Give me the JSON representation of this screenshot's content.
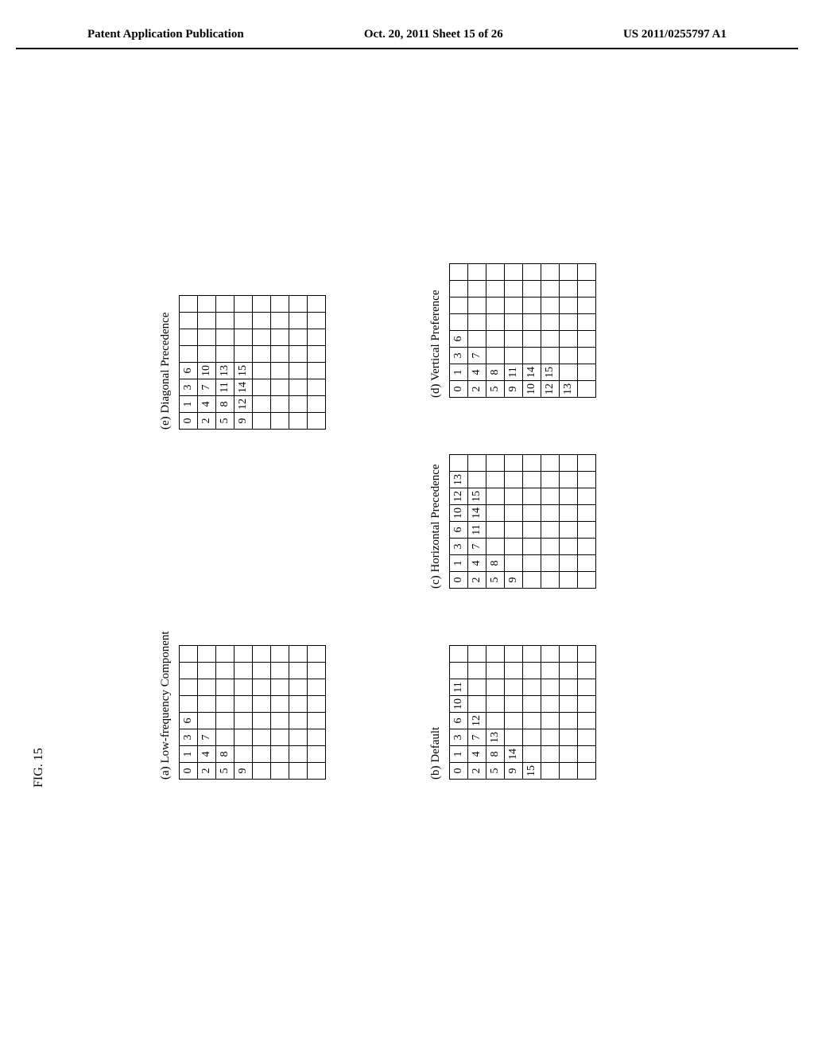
{
  "header": {
    "left": "Patent Application Publication",
    "center": "Oct. 20, 2011  Sheet 15 of 26",
    "right": "US 2011/0255797 A1"
  },
  "figLabel": "FIG. 15",
  "panels": {
    "a": {
      "caption": "(a) Low-frequency Component"
    },
    "b": {
      "caption": "(b) Default"
    },
    "c": {
      "caption": "(c) Horizontal Precedence"
    },
    "d": {
      "caption": "(d) Vertical Preference"
    },
    "e": {
      "caption": "(e) Diagonal Precedence"
    }
  },
  "chart_data": [
    {
      "type": "table",
      "title": "(a) Low-frequency Component",
      "rows": 8,
      "cols": 8,
      "cells": {
        "0,0": "0",
        "0,1": "1",
        "0,2": "3",
        "0,3": "6",
        "1,0": "2",
        "1,1": "4",
        "1,2": "7",
        "2,0": "5",
        "2,1": "8",
        "3,0": "9"
      }
    },
    {
      "type": "table",
      "title": "(b) Default",
      "rows": 8,
      "cols": 8,
      "cells": {
        "0,0": "0",
        "0,1": "1",
        "0,2": "3",
        "0,3": "6",
        "0,4": "10",
        "0,5": "11",
        "1,0": "2",
        "1,1": "4",
        "1,2": "7",
        "1,3": "12",
        "2,0": "5",
        "2,1": "8",
        "2,2": "13",
        "3,0": "9",
        "3,1": "14",
        "4,0": "15"
      }
    },
    {
      "type": "table",
      "title": "(c) Horizontal Precedence",
      "rows": 8,
      "cols": 8,
      "cells": {
        "0,0": "0",
        "0,1": "1",
        "0,2": "3",
        "0,3": "6",
        "0,4": "10",
        "0,5": "12",
        "0,6": "13",
        "1,0": "2",
        "1,1": "4",
        "1,2": "7",
        "1,3": "11",
        "1,4": "14",
        "1,5": "15",
        "2,0": "5",
        "2,1": "8",
        "3,0": "9"
      }
    },
    {
      "type": "table",
      "title": "(d) Vertical Preference",
      "rows": 8,
      "cols": 8,
      "cells": {
        "0,0": "0",
        "0,1": "1",
        "0,2": "3",
        "0,3": "6",
        "1,0": "2",
        "1,1": "4",
        "1,2": "7",
        "2,0": "5",
        "2,1": "8",
        "3,0": "9",
        "3,1": "11",
        "4,0": "10",
        "4,1": "14",
        "5,0": "12",
        "5,1": "15",
        "6,0": "13"
      }
    },
    {
      "type": "table",
      "title": "(e) Diagonal Precedence",
      "rows": 8,
      "cols": 8,
      "cells": {
        "0,0": "0",
        "0,1": "1",
        "0,2": "3",
        "0,3": "6",
        "1,0": "2",
        "1,1": "4",
        "1,2": "7",
        "1,3": "10",
        "2,0": "5",
        "2,1": "8",
        "2,2": "11",
        "2,3": "13",
        "3,0": "9",
        "3,1": "12",
        "3,2": "14",
        "3,3": "15"
      }
    }
  ]
}
